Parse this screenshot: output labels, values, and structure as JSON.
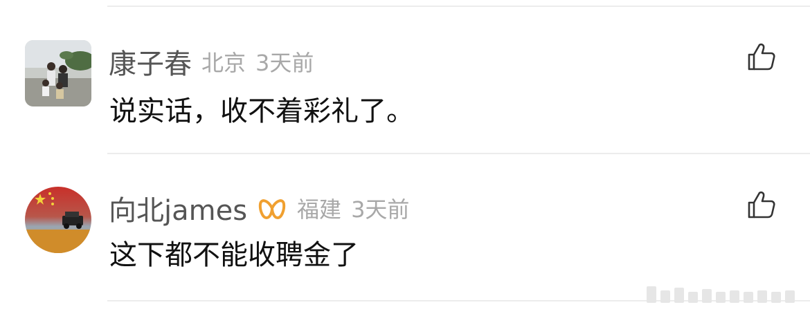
{
  "comments": [
    {
      "username": "康子春",
      "location": "北京",
      "time": "3天前",
      "text": "说实话，收不着彩礼了。",
      "avatar_icon": "family-photo-avatar",
      "like_icon": "thumbs-up-icon"
    },
    {
      "username": "向北james",
      "vip_icon": "vip-badge-icon",
      "vip_color": "#f0a030",
      "location": "福建",
      "time": "3天前",
      "text": "这下都不能收聘金了",
      "avatar_icon": "flag-car-avatar",
      "like_icon": "thumbs-up-icon"
    }
  ],
  "colors": {
    "username": "#555555",
    "meta": "#a8a8a8",
    "text": "#111111",
    "divider": "#ececec"
  }
}
